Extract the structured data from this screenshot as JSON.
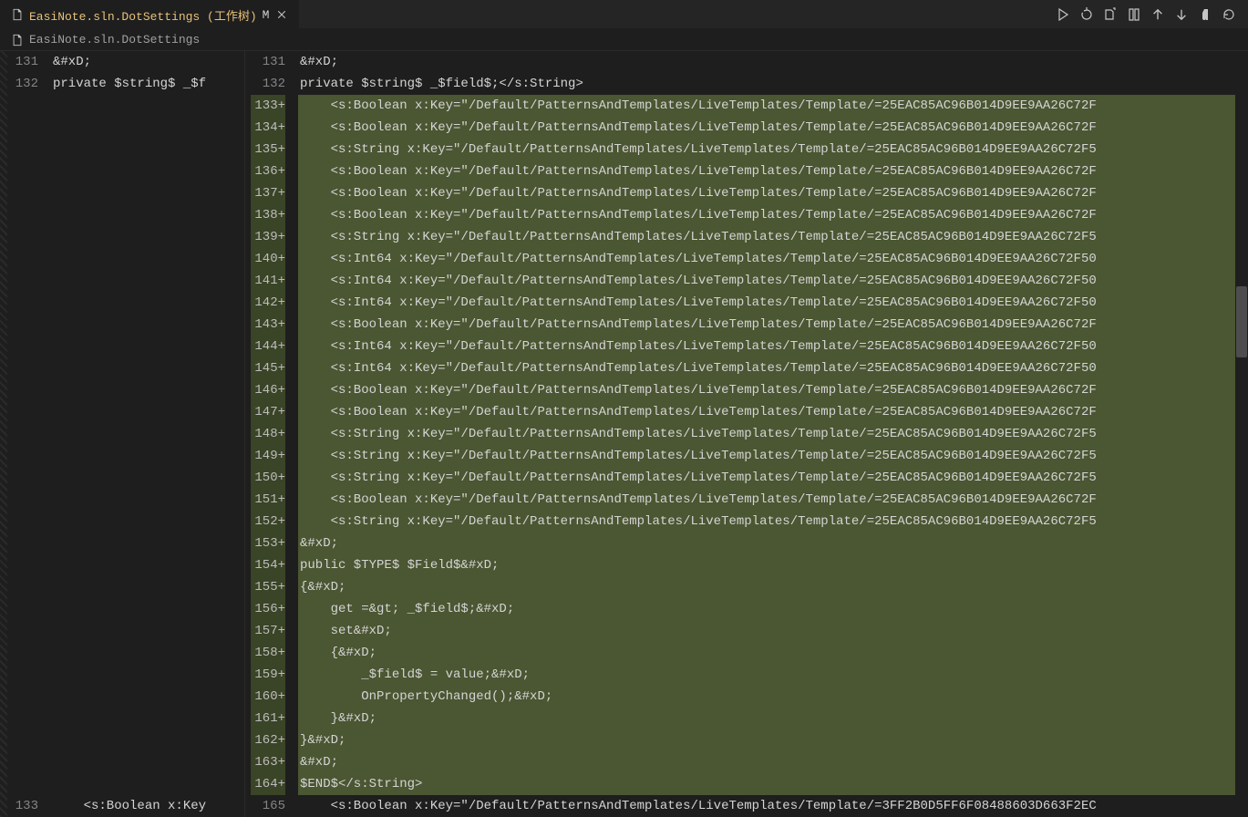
{
  "tab": {
    "file_icon": "file",
    "label": "EasiNote.sln.DotSettings (工作树)",
    "badge": "M",
    "close": "×"
  },
  "breadcrumb": {
    "file_icon": "file",
    "label": "EasiNote.sln.DotSettings"
  },
  "toolbar": {
    "run": "▷",
    "history": "↺",
    "copy": "⧉",
    "diff": "⫿",
    "up": "↑",
    "down": "↓",
    "pilcrow": "¶",
    "more": "↻"
  },
  "left": {
    "lineNumbers": [
      "131",
      "132",
      "",
      "",
      "",
      "",
      "",
      "",
      "",
      "",
      "",
      "",
      "",
      "",
      "",
      "",
      "",
      "",
      "",
      "",
      "",
      "",
      "",
      "",
      "",
      "",
      "",
      "",
      "",
      "",
      "",
      "",
      "",
      "",
      "133"
    ],
    "lines": [
      "&#xD;",
      "private $string$ _$f",
      " ",
      " ",
      " ",
      " ",
      " ",
      " ",
      " ",
      " ",
      " ",
      " ",
      " ",
      " ",
      " ",
      " ",
      " ",
      " ",
      " ",
      " ",
      " ",
      " ",
      " ",
      " ",
      " ",
      " ",
      " ",
      " ",
      " ",
      " ",
      " ",
      " ",
      " ",
      " ",
      "    <s:Boolean x:Key"
    ]
  },
  "right": {
    "rows": [
      {
        "n": "131",
        "plus": false,
        "t": "&#xD;"
      },
      {
        "n": "132",
        "plus": false,
        "t": "private $string$ _$field$;</s:String>"
      },
      {
        "n": "133",
        "plus": true,
        "t": "    <s:Boolean x:Key=\"/Default/PatternsAndTemplates/LiveTemplates/Template/=25EAC85AC96B014D9EE9AA26C72F"
      },
      {
        "n": "134",
        "plus": true,
        "t": "    <s:Boolean x:Key=\"/Default/PatternsAndTemplates/LiveTemplates/Template/=25EAC85AC96B014D9EE9AA26C72F"
      },
      {
        "n": "135",
        "plus": true,
        "t": "    <s:String x:Key=\"/Default/PatternsAndTemplates/LiveTemplates/Template/=25EAC85AC96B014D9EE9AA26C72F5"
      },
      {
        "n": "136",
        "plus": true,
        "t": "    <s:Boolean x:Key=\"/Default/PatternsAndTemplates/LiveTemplates/Template/=25EAC85AC96B014D9EE9AA26C72F"
      },
      {
        "n": "137",
        "plus": true,
        "t": "    <s:Boolean x:Key=\"/Default/PatternsAndTemplates/LiveTemplates/Template/=25EAC85AC96B014D9EE9AA26C72F"
      },
      {
        "n": "138",
        "plus": true,
        "t": "    <s:Boolean x:Key=\"/Default/PatternsAndTemplates/LiveTemplates/Template/=25EAC85AC96B014D9EE9AA26C72F"
      },
      {
        "n": "139",
        "plus": true,
        "t": "    <s:String x:Key=\"/Default/PatternsAndTemplates/LiveTemplates/Template/=25EAC85AC96B014D9EE9AA26C72F5"
      },
      {
        "n": "140",
        "plus": true,
        "t": "    <s:Int64 x:Key=\"/Default/PatternsAndTemplates/LiveTemplates/Template/=25EAC85AC96B014D9EE9AA26C72F50"
      },
      {
        "n": "141",
        "plus": true,
        "t": "    <s:Int64 x:Key=\"/Default/PatternsAndTemplates/LiveTemplates/Template/=25EAC85AC96B014D9EE9AA26C72F50"
      },
      {
        "n": "142",
        "plus": true,
        "t": "    <s:Int64 x:Key=\"/Default/PatternsAndTemplates/LiveTemplates/Template/=25EAC85AC96B014D9EE9AA26C72F50"
      },
      {
        "n": "143",
        "plus": true,
        "t": "    <s:Boolean x:Key=\"/Default/PatternsAndTemplates/LiveTemplates/Template/=25EAC85AC96B014D9EE9AA26C72F"
      },
      {
        "n": "144",
        "plus": true,
        "t": "    <s:Int64 x:Key=\"/Default/PatternsAndTemplates/LiveTemplates/Template/=25EAC85AC96B014D9EE9AA26C72F50"
      },
      {
        "n": "145",
        "plus": true,
        "t": "    <s:Int64 x:Key=\"/Default/PatternsAndTemplates/LiveTemplates/Template/=25EAC85AC96B014D9EE9AA26C72F50"
      },
      {
        "n": "146",
        "plus": true,
        "t": "    <s:Boolean x:Key=\"/Default/PatternsAndTemplates/LiveTemplates/Template/=25EAC85AC96B014D9EE9AA26C72F"
      },
      {
        "n": "147",
        "plus": true,
        "t": "    <s:Boolean x:Key=\"/Default/PatternsAndTemplates/LiveTemplates/Template/=25EAC85AC96B014D9EE9AA26C72F"
      },
      {
        "n": "148",
        "plus": true,
        "t": "    <s:String x:Key=\"/Default/PatternsAndTemplates/LiveTemplates/Template/=25EAC85AC96B014D9EE9AA26C72F5"
      },
      {
        "n": "149",
        "plus": true,
        "t": "    <s:String x:Key=\"/Default/PatternsAndTemplates/LiveTemplates/Template/=25EAC85AC96B014D9EE9AA26C72F5"
      },
      {
        "n": "150",
        "plus": true,
        "t": "    <s:String x:Key=\"/Default/PatternsAndTemplates/LiveTemplates/Template/=25EAC85AC96B014D9EE9AA26C72F5"
      },
      {
        "n": "151",
        "plus": true,
        "t": "    <s:Boolean x:Key=\"/Default/PatternsAndTemplates/LiveTemplates/Template/=25EAC85AC96B014D9EE9AA26C72F"
      },
      {
        "n": "152",
        "plus": true,
        "t": "    <s:String x:Key=\"/Default/PatternsAndTemplates/LiveTemplates/Template/=25EAC85AC96B014D9EE9AA26C72F5"
      },
      {
        "n": "153",
        "plus": true,
        "t": "&#xD;"
      },
      {
        "n": "154",
        "plus": true,
        "t": "public $TYPE$ $Field$&#xD;"
      },
      {
        "n": "155",
        "plus": true,
        "t": "{&#xD;"
      },
      {
        "n": "156",
        "plus": true,
        "t": "    get =&gt; _$field$;&#xD;"
      },
      {
        "n": "157",
        "plus": true,
        "t": "    set&#xD;"
      },
      {
        "n": "158",
        "plus": true,
        "t": "    {&#xD;"
      },
      {
        "n": "159",
        "plus": true,
        "t": "        _$field$ = value;&#xD;"
      },
      {
        "n": "160",
        "plus": true,
        "t": "        OnPropertyChanged();&#xD;"
      },
      {
        "n": "161",
        "plus": true,
        "t": "    }&#xD;"
      },
      {
        "n": "162",
        "plus": true,
        "t": "}&#xD;"
      },
      {
        "n": "163",
        "plus": true,
        "t": "&#xD;"
      },
      {
        "n": "164",
        "plus": true,
        "t": "$END$</s:String>"
      },
      {
        "n": "165",
        "plus": false,
        "t": "    <s:Boolean x:Key=\"/Default/PatternsAndTemplates/LiveTemplates/Template/=3FF2B0D5FF6F08488603D663F2EC"
      }
    ]
  }
}
